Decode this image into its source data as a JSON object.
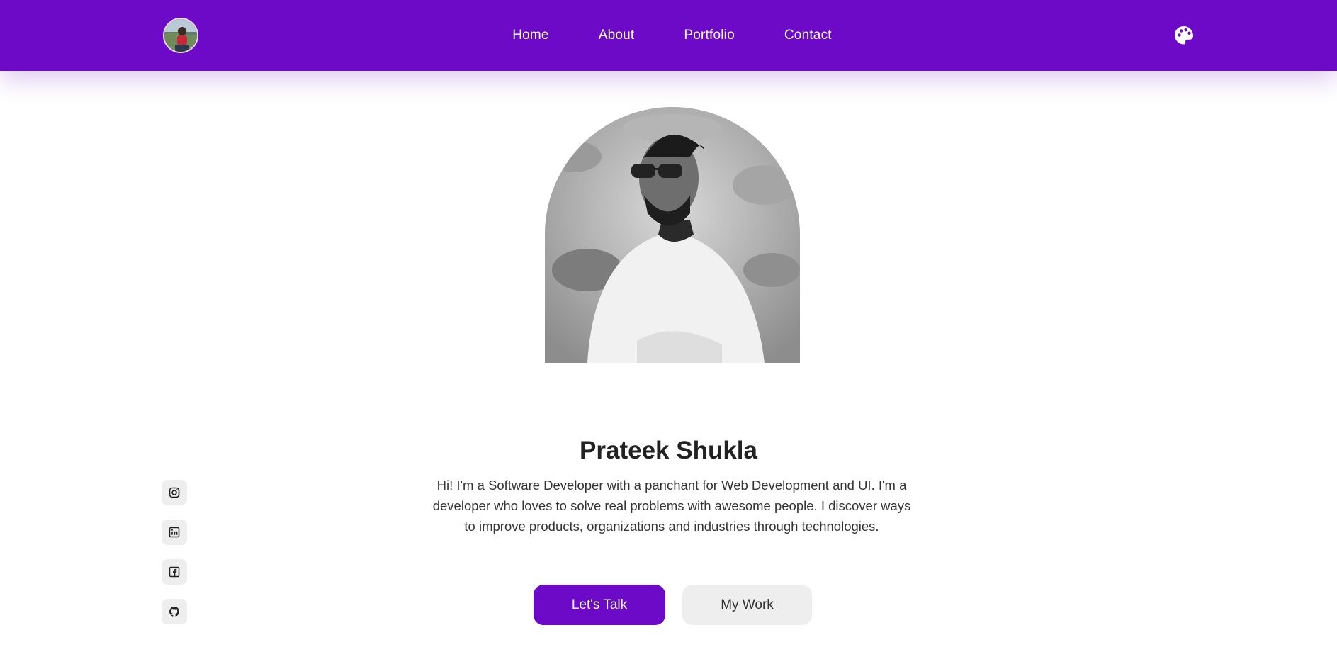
{
  "colors": {
    "accent": "#6c0ac7",
    "background": "#ffffff",
    "secondary_button": "#eeeeee",
    "text": "#222222"
  },
  "header": {
    "logo_icon": "avatar",
    "nav": [
      {
        "label": "Home"
      },
      {
        "label": "About"
      },
      {
        "label": "Portfolio"
      },
      {
        "label": "Contact"
      }
    ],
    "theme_icon": "palette-icon"
  },
  "hero": {
    "photo_icon": "profile-photo",
    "name": "Prateek Shukla",
    "intro": "Hi! I'm a Software Developer with a panchant for Web Development and UI. I'm a developer who loves to solve real problems with awesome people. I discover ways to improve products, organizations and industries through technologies.",
    "primary_button": "Let's Talk",
    "secondary_button": "My Work"
  },
  "socials": [
    {
      "icon": "instagram-icon"
    },
    {
      "icon": "linkedin-icon"
    },
    {
      "icon": "facebook-icon"
    },
    {
      "icon": "github-icon"
    }
  ]
}
